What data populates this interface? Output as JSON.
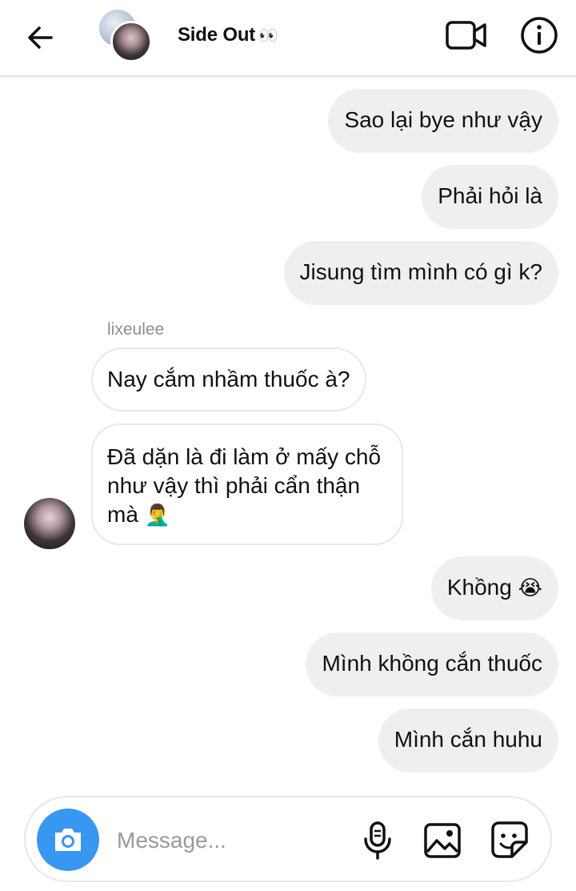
{
  "header": {
    "title": "Side Out",
    "title_emoji": "👀",
    "back_icon": "arrow-left-icon",
    "video_icon": "video-camera-icon",
    "info_icon": "info-icon"
  },
  "messages": [
    {
      "direction": "outgoing",
      "text": "Sao lại bye như vậy"
    },
    {
      "direction": "outgoing",
      "text": "Phải hỏi là"
    },
    {
      "direction": "outgoing",
      "text": "Jisung tìm mình có gì k?"
    },
    {
      "direction": "incoming",
      "sender": "lixeulee",
      "text": "Nay cắm nhầm thuốc à?"
    },
    {
      "direction": "incoming",
      "sender": "lixeulee",
      "text": "Đã dặn là đi làm ở mấy chỗ như vậy thì phải cẩn thận mà",
      "emoji": "🤦‍♂️"
    },
    {
      "direction": "outgoing",
      "text": "Khồng",
      "emoji": "😭"
    },
    {
      "direction": "outgoing",
      "text": "Mình khồng cắn thuốc"
    },
    {
      "direction": "outgoing",
      "text": "Mình cắn huhu"
    }
  ],
  "composer": {
    "placeholder": "Message...",
    "value": "",
    "camera_icon": "camera-icon",
    "mic_icon": "microphone-icon",
    "gallery_icon": "image-icon",
    "sticker_icon": "sticker-icon"
  },
  "colors": {
    "accent": "#3897f0",
    "outgoing_bubble": "#efefef",
    "incoming_bubble": "#ffffff",
    "muted_text": "#8e8e8e"
  }
}
